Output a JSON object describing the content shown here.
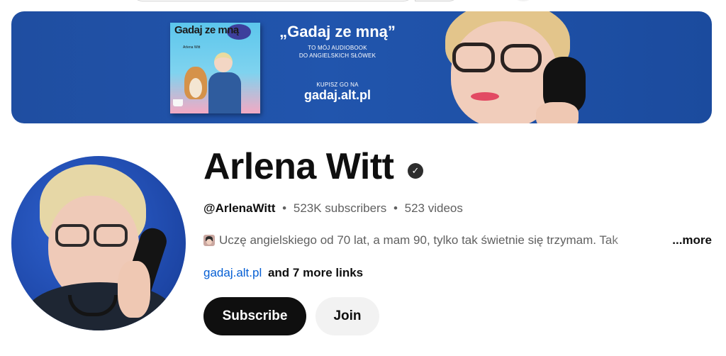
{
  "banner": {
    "cover_title": "Gadaj ze mną",
    "cover_author": "Arlena Witt",
    "quote": "„Gadaj ze mną”",
    "line1": "TO MÓJ AUDIOBOOK",
    "line2": "DO ANGIELSKICH SŁÓWEK",
    "buy_label": "KUPISZ GO NA",
    "url": "gadaj.alt.pl"
  },
  "channel": {
    "name": "Arlena Witt",
    "verified_icon": "✓",
    "handle": "@ArlenaWitt",
    "subscribers": "523K subscribers",
    "videos": "523 videos",
    "separator": "•",
    "description": "Uczę angielskiego od 70 lat, a mam 90, tylko tak świetnie się trzymam. Tak",
    "more_label": "...more",
    "primary_link": "gadaj.alt.pl",
    "more_links": "and 7 more links"
  },
  "actions": {
    "subscribe_label": "Subscribe",
    "join_label": "Join"
  },
  "colors": {
    "banner_bg": "#1f4ea1",
    "link": "#065fd4",
    "subscribe_bg": "#0f0f0f",
    "join_bg": "#f2f2f2"
  }
}
